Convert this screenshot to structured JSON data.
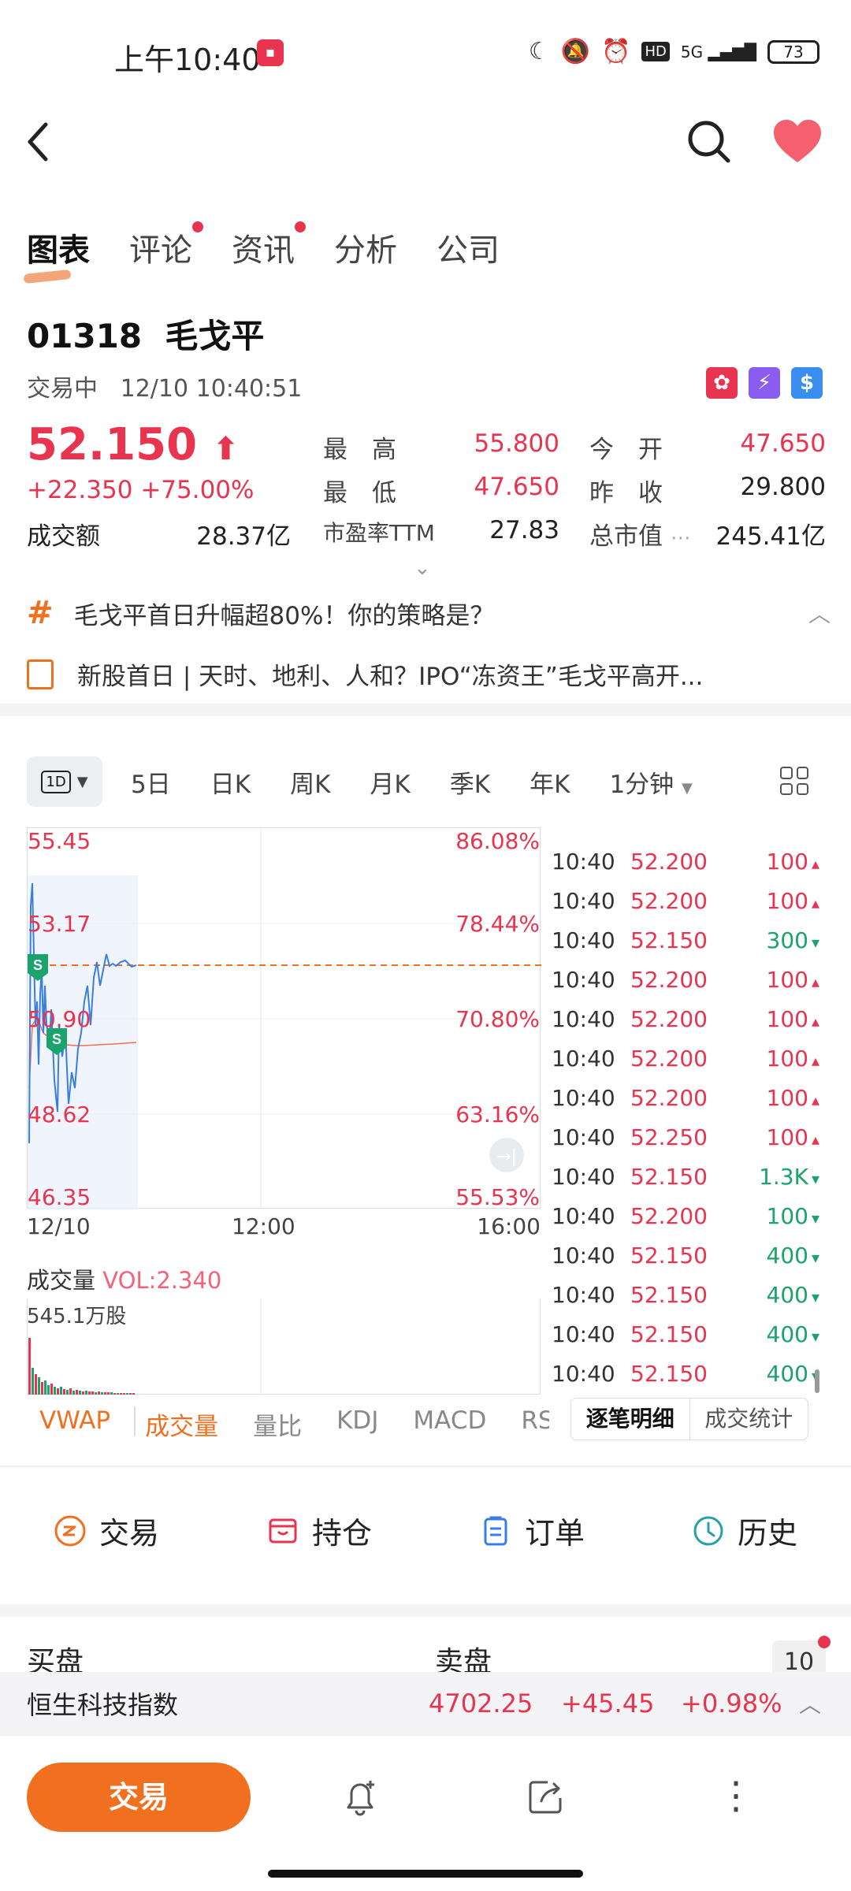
{
  "status_bar": {
    "time": "上午10:40",
    "network": "5G",
    "battery": "73"
  },
  "header": {
    "back_icon": "chevron-left-icon",
    "search_icon": "search-icon",
    "favorite_icon": "heart-icon"
  },
  "tabs": [
    {
      "label": "图表",
      "active": true,
      "dot": false
    },
    {
      "label": "评论",
      "active": false,
      "dot": true
    },
    {
      "label": "资讯",
      "active": false,
      "dot": true
    },
    {
      "label": "分析",
      "active": false,
      "dot": false
    },
    {
      "label": "公司",
      "active": false,
      "dot": false
    }
  ],
  "stock": {
    "code": "01318",
    "name": "毛戈平",
    "status": "交易中",
    "datetime": "12/10 10:40:51",
    "price": "52.150",
    "change": "+22.350",
    "change_pct": "+75.00%",
    "turnover_label": "成交额",
    "turnover": "28.37亿"
  },
  "quote": {
    "high_label": "最　高",
    "high": "55.800",
    "open_label": "今　开",
    "open": "47.650",
    "low_label": "最　低",
    "low": "47.650",
    "prev_close_label": "昨　收",
    "prev_close": "29.800",
    "pe_label": "市盈率TTM",
    "pe": "27.83",
    "mkt_cap_label": "总市值",
    "mkt_cap": "245.41亿"
  },
  "news": [
    "毛戈平首日升幅超80%！你的策略是？",
    "新股首日 | 天时、地利、人和？IPO“冻资王”毛戈平高开..."
  ],
  "periods": {
    "selected": "1D",
    "items": [
      "5日",
      "日K",
      "周K",
      "月K",
      "季K",
      "年K"
    ],
    "interval": "1分钟"
  },
  "chart": {
    "y_left": [
      "55.45",
      "53.17",
      "50.90",
      "48.62",
      "46.35"
    ],
    "y_right": [
      "86.08%",
      "78.44%",
      "70.80%",
      "63.16%",
      "55.53%"
    ],
    "x": [
      "12/10",
      "12:00",
      "16:00"
    ],
    "price_line_color": "#3a7fe0",
    "vwap_color": "#f07050",
    "ref_line_color": "#f07020"
  },
  "ticks": [
    {
      "time": "10:40",
      "price": "52.200",
      "vol": "100",
      "dir": "up"
    },
    {
      "time": "10:40",
      "price": "52.200",
      "vol": "100",
      "dir": "up"
    },
    {
      "time": "10:40",
      "price": "52.150",
      "vol": "300",
      "dir": "down"
    },
    {
      "time": "10:40",
      "price": "52.200",
      "vol": "100",
      "dir": "up"
    },
    {
      "time": "10:40",
      "price": "52.200",
      "vol": "100",
      "dir": "up"
    },
    {
      "time": "10:40",
      "price": "52.200",
      "vol": "100",
      "dir": "up"
    },
    {
      "time": "10:40",
      "price": "52.200",
      "vol": "100",
      "dir": "up"
    },
    {
      "time": "10:40",
      "price": "52.250",
      "vol": "100",
      "dir": "up"
    },
    {
      "time": "10:40",
      "price": "52.150",
      "vol": "1.3K",
      "dir": "down"
    },
    {
      "time": "10:40",
      "price": "52.200",
      "vol": "100",
      "dir": "down"
    },
    {
      "time": "10:40",
      "price": "52.150",
      "vol": "400",
      "dir": "down"
    },
    {
      "time": "10:40",
      "price": "52.150",
      "vol": "400",
      "dir": "down"
    },
    {
      "time": "10:40",
      "price": "52.150",
      "vol": "400",
      "dir": "down"
    },
    {
      "time": "10:40",
      "price": "52.150",
      "vol": "400",
      "dir": "down"
    }
  ],
  "volume": {
    "label": "成交量",
    "vol_value": "VOL:2.340",
    "max": "545.1万股"
  },
  "indicators": [
    {
      "label": "VWAP",
      "on": true
    },
    {
      "label": "成交量",
      "on": true
    },
    {
      "label": "量比",
      "on": false
    },
    {
      "label": "KDJ",
      "on": false
    },
    {
      "label": "MACD",
      "on": false
    },
    {
      "label": "RS",
      "on": false
    }
  ],
  "tick_tabs": [
    "逐笔明细",
    "成交统计"
  ],
  "actions": [
    {
      "label": "交易",
      "icon": "trade-icon",
      "color": "#f07020"
    },
    {
      "label": "持仓",
      "icon": "position-icon",
      "color": "#e8344e"
    },
    {
      "label": "订单",
      "icon": "order-icon",
      "color": "#3a7fe0"
    },
    {
      "label": "历史",
      "icon": "history-icon",
      "color": "#27a0a8"
    }
  ],
  "order_book": {
    "buy": "买盘",
    "sell": "卖盘",
    "depth": "10"
  },
  "index_bar": {
    "name": "恒生科技指数",
    "value": "4702.25",
    "change": "+45.45",
    "pct": "+0.98%"
  },
  "bottom": {
    "trade_label": "交易"
  }
}
